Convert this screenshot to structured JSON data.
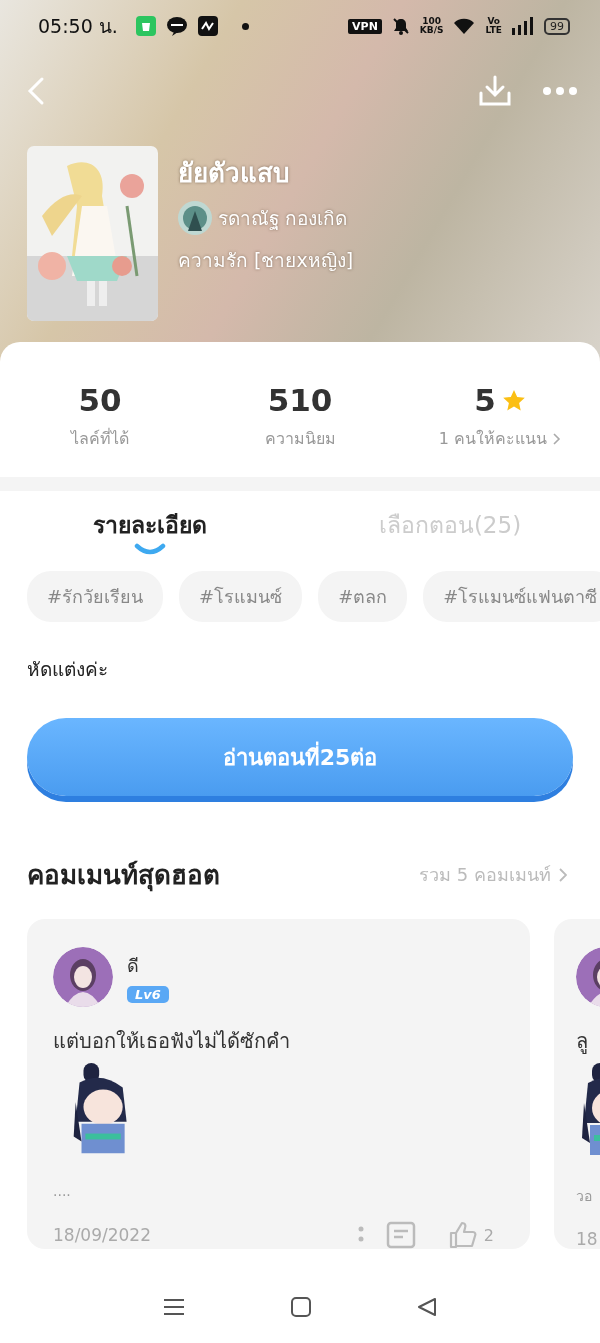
{
  "status_bar": {
    "time": "05:50 น.",
    "vpn": "VPN",
    "speed": [
      "100",
      "KB/S"
    ],
    "network": [
      "Vo",
      "LTE"
    ],
    "battery": "99"
  },
  "book": {
    "title": "ยัยตัวแสบ",
    "author": "รดาณัฐ กองเกิด",
    "genre": "ความรัก [ชายxหญิง]"
  },
  "stats": [
    {
      "kind": "count",
      "value": "50",
      "label": "ไลค์ที่ได้"
    },
    {
      "kind": "count",
      "value": "510",
      "label": "ความนิยม"
    },
    {
      "kind": "rating",
      "value": "5",
      "label": "1 คนให้คะแนน"
    }
  ],
  "tabs": [
    {
      "label": "รายละเอียด",
      "selected": true
    },
    {
      "label": "เลือกตอน(25)",
      "selected": false
    }
  ],
  "tags": [
    "#รักวัยเรียน",
    "#โรแมนซ์",
    "#ตลก",
    "#โรแมนซ์แฟนตาซี"
  ],
  "description": "หัดแต่งค่ะ",
  "read_button": "อ่านตอนที่25ต่อ",
  "comments_section": {
    "title": "คอมเมนท์สุดฮอต",
    "total": "รวม 5 คอมเมนท์"
  },
  "comments": [
    {
      "user": "ดี",
      "level": "Lv6",
      "text": "แต่บอกให้เธอฟังไม่ได้ซักคำ",
      "sticker": true,
      "more": "....",
      "date": "18/09/2022",
      "likes": "2"
    },
    {
      "text": "ลู",
      "sticker": true,
      "more": "วอ",
      "date": "18"
    }
  ]
}
